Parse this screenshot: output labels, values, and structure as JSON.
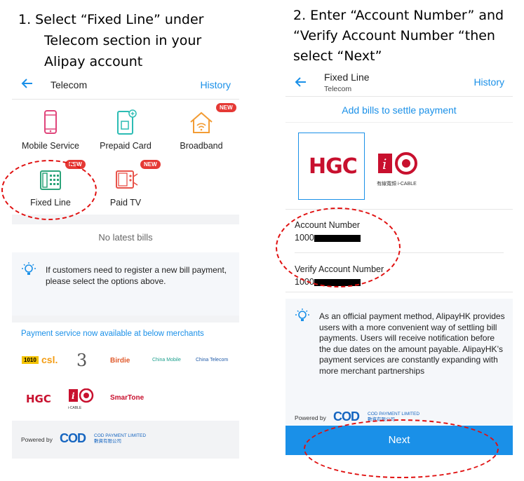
{
  "step1": {
    "lines": [
      "1.   Select “Fixed Line” under",
      "Telecom section in your",
      "Alipay account"
    ]
  },
  "step2": {
    "lines": [
      "2. Enter “Account Number” and",
      "“Verify Account Number “then",
      "select “Next”"
    ]
  },
  "left": {
    "title": "Telecom",
    "history": "History",
    "categories": [
      {
        "label": "Mobile Service",
        "icon": "phone-icon"
      },
      {
        "label": "Prepaid Card",
        "icon": "sim-card-icon"
      },
      {
        "label": "Broadband",
        "icon": "house-wifi-icon",
        "badge": "NEW"
      },
      {
        "label": "Fixed Line",
        "icon": "desk-phone-icon",
        "badge": "NEW"
      },
      {
        "label": "Paid TV",
        "icon": "tv-icon",
        "badge": "NEW"
      }
    ],
    "no_bills": "No latest bills",
    "info": "If customers need to register a new bill payment, please select the options above.",
    "merchant_title": "Payment service now available at below merchants",
    "merchants_row1": [
      "1010",
      "csl.",
      "3",
      "Birdie",
      "China Mobile",
      "China Telecom"
    ],
    "merchants_row2": [
      "HGC",
      "i-CABLE",
      "SmarTone"
    ],
    "powered_by": "Powered by",
    "cod_logo": "COD",
    "cod_name": "COD PAYMENT LIMITED",
    "cod_name_cn": "數資有限公司"
  },
  "right": {
    "title": "Fixed Line",
    "subtitle": "Telecom",
    "history": "History",
    "add_bills": "Add bills to settle payment",
    "hgc": "HGC",
    "icable": "i-CABLE",
    "icable_cn": "有線寬頻",
    "account_label": "Account Number",
    "account_value": "1000",
    "verify_label": "Verify Account Number",
    "verify_value": "1000",
    "info": "As an official payment method, AlipayHK provides users with a more convenient way of settling bill payments. Users will receive notification before the due dates on the amount payable. AlipayHK’s payment services are constantly expanding with more merchant partnerships",
    "powered_by": "Powered by",
    "cod_logo": "COD",
    "cod_name": "COD PAYMENT LIMITED",
    "cod_name_cn": "數資有限公司",
    "next": "Next"
  },
  "colors": {
    "accent": "#1a90e8",
    "annotation": "#e01010",
    "hgc_red": "#c8102e"
  }
}
